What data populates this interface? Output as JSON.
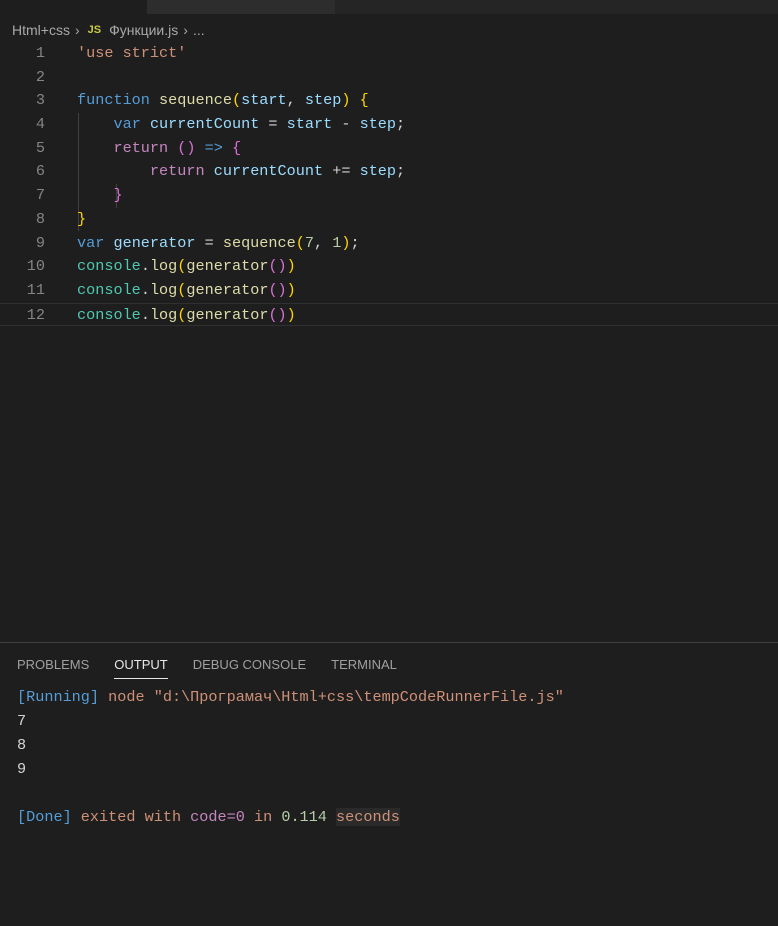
{
  "breadcrumb": {
    "folder": "Html+css",
    "file_icon": "JS",
    "file": "Функции.js",
    "more": "..."
  },
  "editor": {
    "lines": [
      [
        [
          "'use strict'",
          "st"
        ]
      ],
      [],
      [
        [
          "function ",
          "kw"
        ],
        [
          "sequence",
          "fn"
        ],
        [
          "(",
          "b1"
        ],
        [
          "start",
          "vr"
        ],
        [
          ", ",
          "pl"
        ],
        [
          "step",
          "vr"
        ],
        [
          ") ",
          "b1"
        ],
        [
          "{",
          "b1"
        ]
      ],
      [
        [
          "    ",
          "pl"
        ],
        [
          "var ",
          "kw"
        ],
        [
          "currentCount",
          "vr"
        ],
        [
          " = ",
          "pl"
        ],
        [
          "start",
          "vr"
        ],
        [
          " - ",
          "pl"
        ],
        [
          "step",
          "vr"
        ],
        [
          ";",
          "pl"
        ]
      ],
      [
        [
          "    ",
          "pl"
        ],
        [
          "return ",
          "ct"
        ],
        [
          "()",
          "b2"
        ],
        [
          " => ",
          "kw"
        ],
        [
          "{",
          "b2"
        ]
      ],
      [
        [
          "        ",
          "pl"
        ],
        [
          "return ",
          "ct"
        ],
        [
          "currentCount",
          "vr"
        ],
        [
          " += ",
          "pl"
        ],
        [
          "step",
          "vr"
        ],
        [
          ";",
          "pl"
        ]
      ],
      [
        [
          "    ",
          "pl"
        ],
        [
          "}",
          "b2"
        ]
      ],
      [
        [
          "}",
          "b1"
        ]
      ],
      [
        [
          "var ",
          "kw"
        ],
        [
          "generator",
          "vr"
        ],
        [
          " = ",
          "pl"
        ],
        [
          "sequence",
          "fn"
        ],
        [
          "(",
          "b1"
        ],
        [
          "7",
          "nm"
        ],
        [
          ", ",
          "pl"
        ],
        [
          "1",
          "nm"
        ],
        [
          ")",
          "b1"
        ],
        [
          ";",
          "pl"
        ]
      ],
      [
        [
          "console",
          "ob"
        ],
        [
          ".",
          "pl"
        ],
        [
          "log",
          "fn"
        ],
        [
          "(",
          "b1"
        ],
        [
          "generator",
          "fn"
        ],
        [
          "()",
          "b2"
        ],
        [
          ")",
          "b1"
        ]
      ],
      [
        [
          "console",
          "ob"
        ],
        [
          ".",
          "pl"
        ],
        [
          "log",
          "fn"
        ],
        [
          "(",
          "b1"
        ],
        [
          "generator",
          "fn"
        ],
        [
          "()",
          "b2"
        ],
        [
          ")",
          "b1"
        ]
      ],
      [
        [
          "console",
          "ob"
        ],
        [
          ".",
          "pl"
        ],
        [
          "log",
          "fn"
        ],
        [
          "(",
          "b1"
        ],
        [
          "generator",
          "fn"
        ],
        [
          "()",
          "b2"
        ],
        [
          ")",
          "b1"
        ]
      ]
    ]
  },
  "panel": {
    "tabs": [
      "PROBLEMS",
      "OUTPUT",
      "DEBUG CONSOLE",
      "TERMINAL"
    ],
    "active_tab": "OUTPUT",
    "output": {
      "running_tag": "[Running]",
      "command": " node \"d:\\Програмач\\Html+css\\tempCodeRunnerFile.js\"",
      "results": [
        "7",
        "8",
        "9"
      ],
      "done_tag": "[Done]",
      "exited": " exited with ",
      "code": "code=0",
      "in": " in ",
      "time": "0.114",
      "seconds": "seconds"
    }
  }
}
